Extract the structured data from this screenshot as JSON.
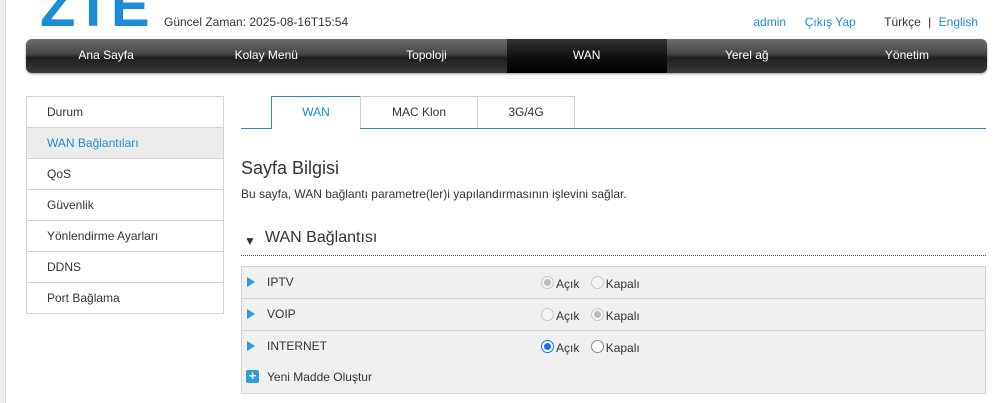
{
  "header": {
    "logo_text": "ZTE",
    "time_label": "Güncel Zaman: 2025-08-16T15:54",
    "user": "admin",
    "logout": "Çıkış Yap",
    "lang_current": "Türkçe",
    "lang_sep": "|",
    "lang_other": "English",
    "brand_color": "#1a8cd8"
  },
  "nav": {
    "items": [
      "Ana Sayfa",
      "Kolay Menü",
      "Topoloji",
      "WAN",
      "Yerel ağ",
      "Yönetim"
    ],
    "active": "WAN"
  },
  "sidebar": {
    "items": [
      "Durum",
      "WAN Bağlantıları",
      "QoS",
      "Güvenlik",
      "Yönlendirme Ayarları",
      "DDNS",
      "Port Bağlama"
    ],
    "active": "WAN Bağlantıları"
  },
  "tabs": {
    "items": [
      "WAN",
      "MAC Klon",
      "3G/4G"
    ],
    "active": "WAN"
  },
  "page_info": {
    "title": "Sayfa Bilgisi",
    "description": "Bu sayfa, WAN bağlantı parametre(ler)i yapılandırmasının işlevini sağlar."
  },
  "wan_section": {
    "toggle_icon": "triangle-down-icon",
    "title": "WAN Bağlantısı",
    "on_label": "Açık",
    "off_label": "Kapalı",
    "rows": [
      {
        "name": "IPTV",
        "state": "Açık",
        "enabled": false
      },
      {
        "name": "VOIP",
        "state": "Kapalı",
        "enabled": false
      },
      {
        "name": "INTERNET",
        "state": "Açık",
        "enabled": true
      }
    ],
    "add_label": "Yeni Madde Oluştur"
  }
}
